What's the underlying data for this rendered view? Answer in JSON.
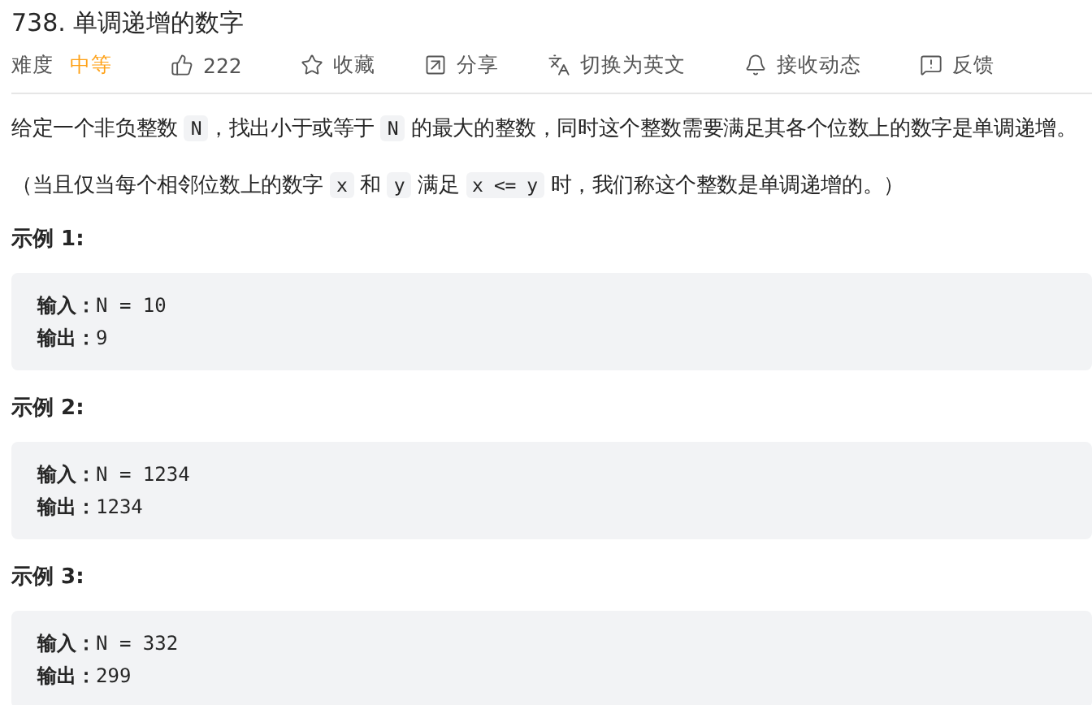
{
  "title": "738. 单调递增的数字",
  "meta": {
    "difficulty_label": "难度",
    "difficulty": "中等",
    "actions": [
      {
        "kind": "like",
        "label": "222"
      },
      {
        "kind": "star",
        "label": "收藏"
      },
      {
        "kind": "share",
        "label": "分享"
      },
      {
        "kind": "translate",
        "label": "切换为英文"
      },
      {
        "kind": "notify",
        "label": "接收动态"
      },
      {
        "kind": "feedback",
        "label": "反馈"
      }
    ]
  },
  "paragraphs": [
    [
      {
        "kind": "text",
        "text": "给定一个非负整数 "
      },
      {
        "kind": "code",
        "text": "N"
      },
      {
        "kind": "text",
        "text": "，找出小于或等于 "
      },
      {
        "kind": "code",
        "text": "N"
      },
      {
        "kind": "text",
        "text": " 的最大的整数，同时这个整数需要满足其各个位数上的数字是单调递增。"
      }
    ],
    [
      {
        "kind": "text",
        "text": "（当且仅当每个相邻位数上的数字 "
      },
      {
        "kind": "code",
        "text": "x"
      },
      {
        "kind": "text",
        "text": " 和 "
      },
      {
        "kind": "code",
        "text": "y"
      },
      {
        "kind": "text",
        "text": " 满足 "
      },
      {
        "kind": "code",
        "text": "x <= y"
      },
      {
        "kind": "text",
        "text": " 时，我们称这个整数是单调递增的。）"
      }
    ]
  ],
  "examples": [
    {
      "heading": "示例 1:",
      "input_label": "输入：",
      "input": "N = 10",
      "output_label": "输出：",
      "output": "9"
    },
    {
      "heading": "示例 2:",
      "input_label": "输入：",
      "input": "N = 1234",
      "output_label": "输出：",
      "output": "1234"
    },
    {
      "heading": "示例 3:",
      "input_label": "输入：",
      "input": "N = 332",
      "output_label": "输出：",
      "output": "299"
    }
  ]
}
